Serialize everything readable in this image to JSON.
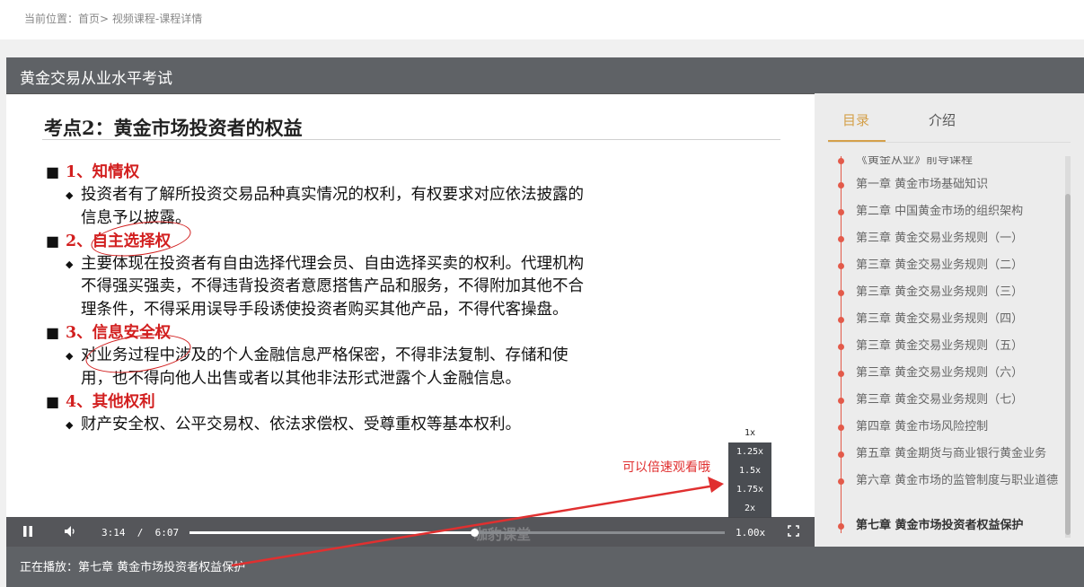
{
  "breadcrumb": {
    "prefix": "当前位置：",
    "home": "首页",
    "sep": ">",
    "current": " 视频课程-课程详情"
  },
  "course": {
    "title": "黄金交易从业水平考试"
  },
  "slide": {
    "title": "考点2：黄金市场投资者的权益",
    "sections": [
      {
        "heading": "1、知情权",
        "body": "投资者有了解所投资交易品种真实情况的权利，有权要求对应依法披露的信息予以披露。"
      },
      {
        "heading": "2、自主选择权",
        "body": "主要体现在投资者有自由选择代理会员、自由选择买卖的权利。代理机构不得强买强卖，不得违背投资者意愿搭售产品和服务，不得附加其他不合理条件，不得采用误导手段诱使投资者购买其他产品，不得代客操盘。"
      },
      {
        "heading": "3、信息安全权",
        "body": "对业务过程中涉及的个人金融信息严格保密，不得非法复制、存储和使用，也不得向他人出售或者以其他非法形式泄露个人金融信息。"
      },
      {
        "heading": "4、其他权利",
        "body": "财产安全权、公平交易权、依法求偿权、受尊重权等基本权利。"
      }
    ],
    "bullet": "■",
    "sub_bullet": "◆"
  },
  "annotation": {
    "hint": "可以倍速观看哦"
  },
  "player": {
    "current_time": "3:14",
    "separator": "/",
    "duration": "6:07",
    "progress": 0.532,
    "rate": "1.00x",
    "speed_options": [
      "1x",
      "1.25x",
      "1.5x",
      "1.75x",
      "2x"
    ],
    "watermark": "咖豹课堂"
  },
  "now_playing": {
    "label": "正在播放：",
    "title": "第七章 黄金市场投资者权益保护"
  },
  "sidebar": {
    "tabs": [
      {
        "label": "目录"
      },
      {
        "label": "介绍"
      }
    ],
    "items": [
      {
        "label": "《黄金从业》前导课程"
      },
      {
        "label": "第一章 黄金市场基础知识"
      },
      {
        "label": "第二章 中国黄金市场的组织架构"
      },
      {
        "label": "第三章 黄金交易业务规则（一）"
      },
      {
        "label": "第三章 黄金交易业务规则（二）"
      },
      {
        "label": "第三章 黄金交易业务规则（三）"
      },
      {
        "label": "第三章 黄金交易业务规则（四）"
      },
      {
        "label": "第三章 黄金交易业务规则（五）"
      },
      {
        "label": "第三章 黄金交易业务规则（六）"
      },
      {
        "label": "第三章 黄金交易业务规则（七）"
      },
      {
        "label": "第四章 黄金市场风险控制"
      },
      {
        "label": "第五章 黄金期货与商业银行黄金业务"
      },
      {
        "label": "第六章 黄金市场的监管制度与职业道德"
      },
      {
        "label": "第七章 黄金市场投资者权益保护"
      }
    ]
  },
  "colors": {
    "accent": "#d4a04a",
    "timeline": "#e35a4a",
    "annotation": "#e03030"
  }
}
